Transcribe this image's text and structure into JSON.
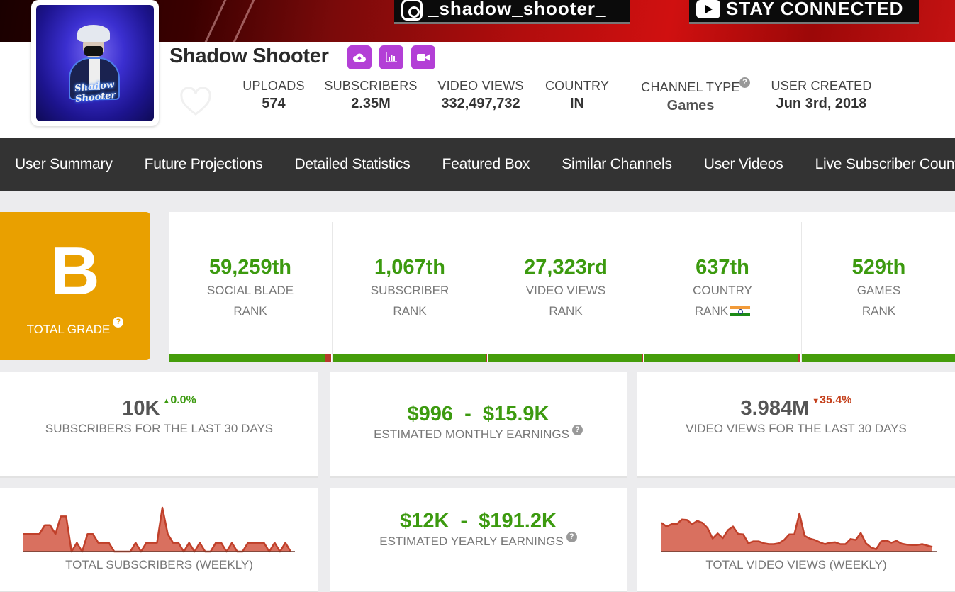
{
  "banner": {
    "instagram_handle": "_shadow_shooter_",
    "stay_connected": "STAY CONNECTED"
  },
  "channel": {
    "name": "Shadow Shooter",
    "avatar_text": "Shadow Shooter",
    "actions": [
      {
        "name": "upload",
        "icon": "cloud-upload-icon"
      },
      {
        "name": "stats",
        "icon": "bar-chart-icon"
      },
      {
        "name": "video",
        "icon": "video-camera-icon"
      }
    ],
    "favorite_icon": "heart-icon"
  },
  "stats": {
    "uploads": {
      "label": "UPLOADS",
      "value": "574"
    },
    "subscribers": {
      "label": "SUBSCRIBERS",
      "value": "2.35M"
    },
    "video_views": {
      "label": "VIDEO VIEWS",
      "value": "332,497,732"
    },
    "country": {
      "label": "COUNTRY",
      "value": "IN"
    },
    "channel_type": {
      "label": "CHANNEL TYPE",
      "value": "Games"
    },
    "user_created": {
      "label": "USER CREATED",
      "value": "Jun 3rd, 2018"
    }
  },
  "nav": {
    "items": [
      "User Summary",
      "Future Projections",
      "Detailed Statistics",
      "Featured Box",
      "Similar Channels",
      "User Videos",
      "Live Subscriber Count"
    ]
  },
  "grade": {
    "letter": "B",
    "label": "TOTAL GRADE",
    "help": "?"
  },
  "ranks": [
    {
      "value": "59,259th",
      "line1": "SOCIAL BLADE",
      "line2": "RANK",
      "percentile": 0.96
    },
    {
      "value": "1,067th",
      "line1": "SUBSCRIBER",
      "line2": "RANK",
      "percentile": 0.99
    },
    {
      "value": "27,323rd",
      "line1": "VIDEO VIEWS",
      "line2": "RANK",
      "percentile": 0.995
    },
    {
      "value": "637th",
      "line1": "COUNTRY",
      "line2": "RANK",
      "percentile": 0.98
    },
    {
      "value": "529th",
      "line1": "GAMES",
      "line2": "RANK",
      "percentile": 0.99
    }
  ],
  "cards": {
    "subs_30d": {
      "value": "10K",
      "delta": "0.0%",
      "delta_dir": "up",
      "label": "SUBSCRIBERS FOR THE LAST 30 DAYS"
    },
    "monthly_earnings": {
      "value": "$996  -  $15.9K",
      "label": "ESTIMATED MONTHLY EARNINGS"
    },
    "views_30d": {
      "value": "3.984M",
      "delta": "35.4%",
      "delta_dir": "down",
      "label": "VIDEO VIEWS FOR THE LAST 30 DAYS"
    },
    "yearly_earnings": {
      "value": "$12K  -  $191.2K",
      "label": "ESTIMATED YEARLY EARNINGS"
    },
    "subs_weekly": {
      "label": "TOTAL SUBSCRIBERS (WEEKLY)"
    },
    "views_weekly": {
      "label": "TOTAL VIDEO VIEWS (WEEKLY)"
    }
  },
  "colors": {
    "accent_purple": "#b33fd6",
    "grade_orange": "#e9a000",
    "rank_green": "#3c9a0f",
    "bar_red": "#b63a2c",
    "sparkline_fill": "#d9705f",
    "sparkline_stroke": "#c0402a",
    "nav_bg": "#333333"
  },
  "chart_data": [
    {
      "type": "area",
      "title": "TOTAL SUBSCRIBERS (WEEKLY)",
      "series": [
        {
          "name": "subscribers",
          "values": [
            2,
            2,
            2,
            2,
            3,
            3,
            2,
            4,
            4,
            0,
            1,
            0,
            2,
            2,
            1,
            1,
            1,
            0,
            0,
            0,
            0,
            1,
            0,
            1,
            1,
            1,
            5,
            2,
            1,
            1,
            0,
            1,
            0,
            1,
            0,
            0,
            1,
            1,
            0,
            1,
            0,
            0,
            1,
            1,
            1,
            1,
            0,
            1,
            0,
            1,
            0
          ]
        }
      ],
      "ylim": [
        0,
        5
      ]
    },
    {
      "type": "area",
      "title": "TOTAL VIDEO VIEWS (WEEKLY)",
      "series": [
        {
          "name": "views",
          "values": [
            6.2,
            5.4,
            5.9,
            5.9,
            6.9,
            6.8,
            5.9,
            6.6,
            6.2,
            5.1,
            2.8,
            3.9,
            2.9,
            4.6,
            5.4,
            3.8,
            3.7,
            1.8,
            2.2,
            2.2,
            1.8,
            1.6,
            1.6,
            1.8,
            2.5,
            3.7,
            3.7,
            8.2,
            3.4,
            2.8,
            2.5,
            2.0,
            1.6,
            1.9,
            2.0,
            1.6,
            1.6,
            2.7,
            2.5,
            4.0,
            1.8,
            0.9,
            0.5,
            2.2,
            2.4,
            1.9,
            2.3,
            1.7,
            1.5,
            1.4,
            1.4,
            1.6,
            1.3,
            1.0
          ]
        }
      ],
      "ylim": [
        0,
        9
      ]
    }
  ]
}
